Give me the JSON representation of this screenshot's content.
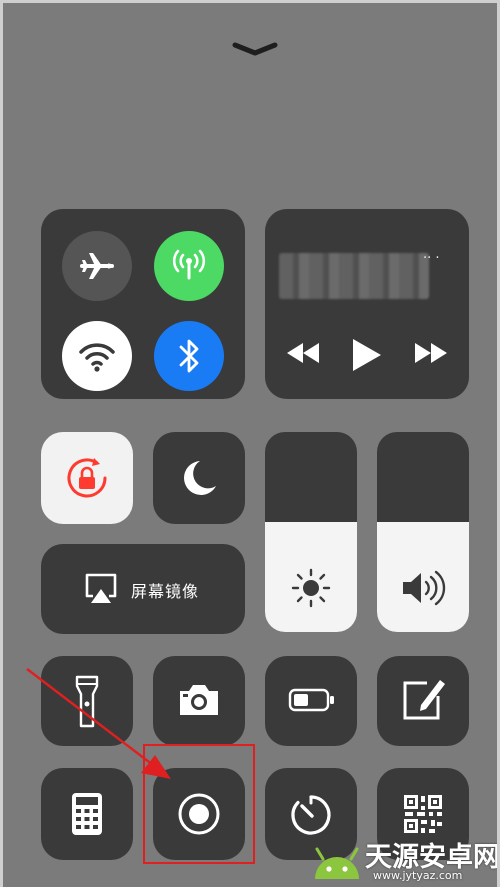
{
  "control_center": {
    "handle_icon": "chevron-down-icon",
    "connectivity": {
      "airplane": {
        "icon": "airplane-icon",
        "active": false
      },
      "cellular": {
        "icon": "antenna-icon",
        "active": true,
        "color": "#4cd964"
      },
      "wifi": {
        "icon": "wifi-icon",
        "active": true
      },
      "bluetooth": {
        "icon": "bluetooth-icon",
        "active": true,
        "color": "#1a7cf5"
      }
    },
    "media": {
      "track": "",
      "controls": [
        "rewind-icon",
        "play-icon",
        "fast-forward-icon"
      ]
    },
    "rotation_lock": {
      "icon": "rotation-lock-icon",
      "active": true,
      "color": "#ff3b30"
    },
    "do_not_disturb": {
      "icon": "moon-icon",
      "active": false
    },
    "screen_mirroring": {
      "label": "屏幕镜像",
      "icon": "airplay-icon"
    },
    "brightness": {
      "icon": "sun-icon",
      "level": 0.55
    },
    "volume": {
      "icon": "speaker-icon",
      "level": 0.55
    },
    "shortcuts_row1": [
      "flashlight-icon",
      "camera-icon",
      "battery-icon",
      "notes-icon"
    ],
    "shortcuts_row2": [
      "calculator-icon",
      "screen-record-icon",
      "timer-icon",
      "qr-code-icon"
    ]
  },
  "annotation": {
    "highlight_color": "#e02020"
  },
  "watermark": {
    "title": "天源安卓网",
    "url": "www.jytyaz.com"
  }
}
